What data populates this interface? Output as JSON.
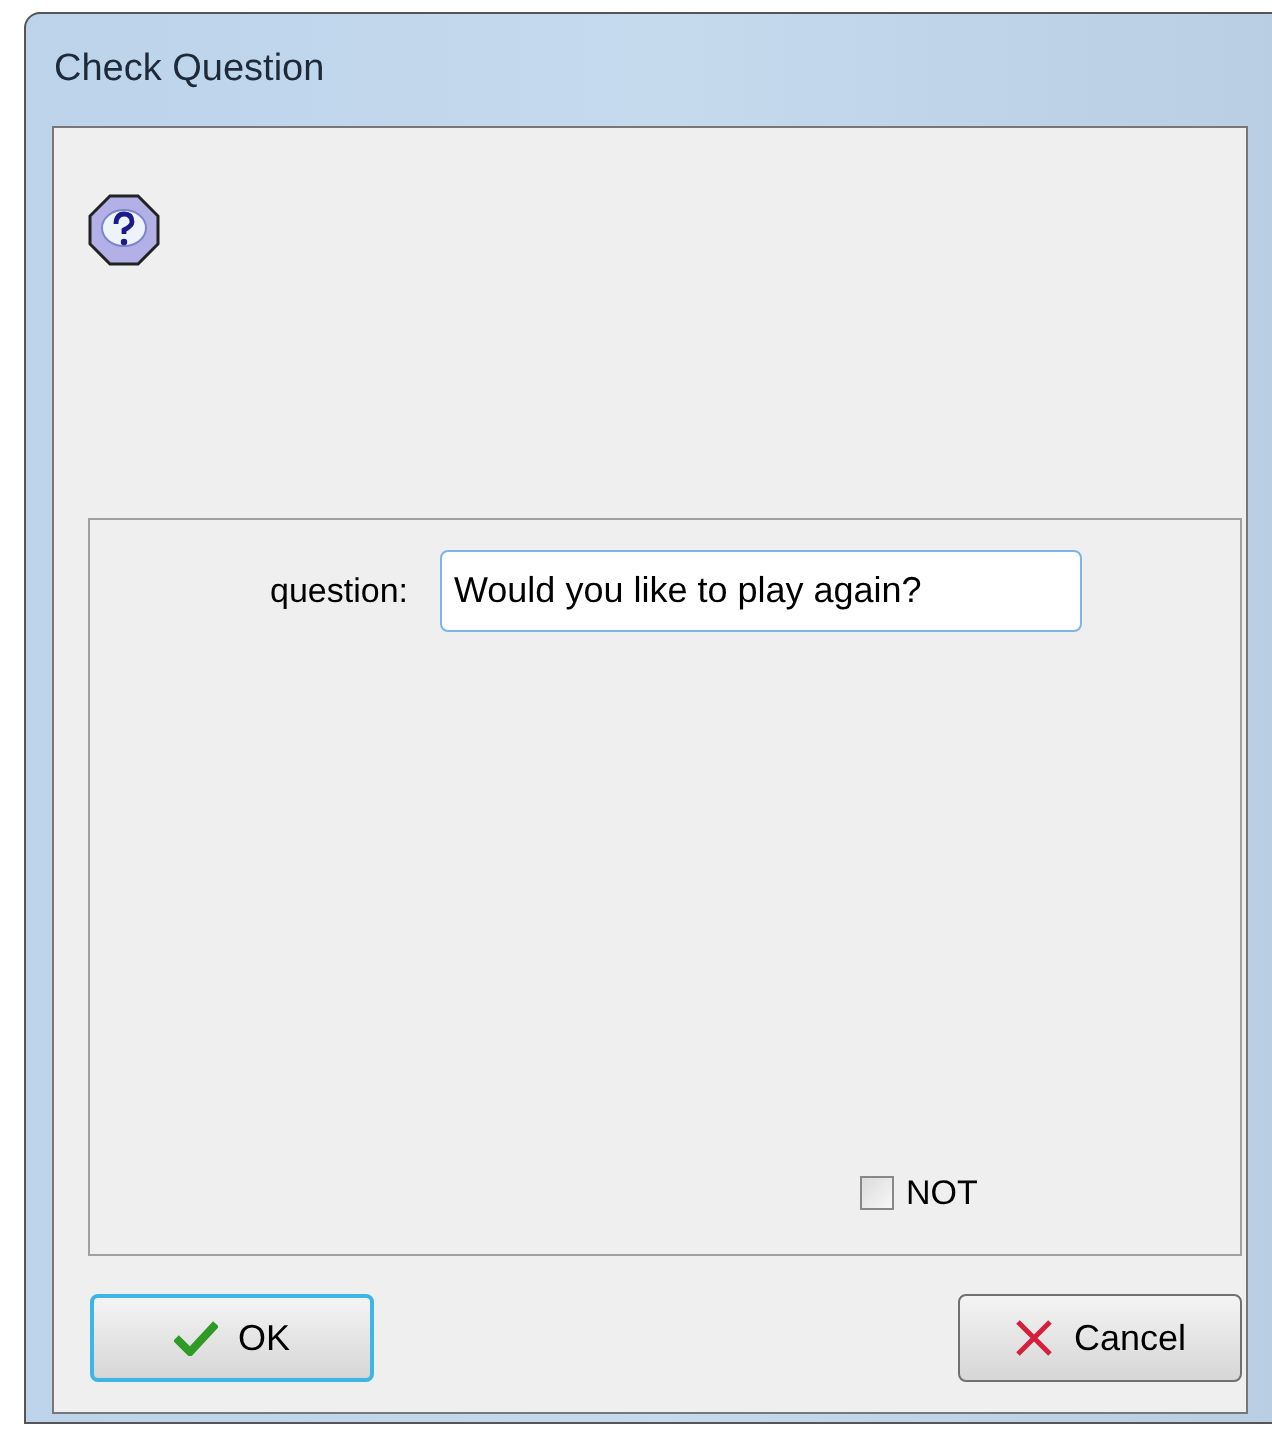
{
  "window": {
    "title": "Check Question"
  },
  "field": {
    "label": "question:",
    "value": "Would you like to play again?"
  },
  "checkbox": {
    "label": "NOT",
    "checked": false
  },
  "buttons": [
    {
      "kind": "ok",
      "label": "OK",
      "focused": true
    },
    {
      "kind": "cancel",
      "label": "Cancel",
      "focused": false
    }
  ]
}
